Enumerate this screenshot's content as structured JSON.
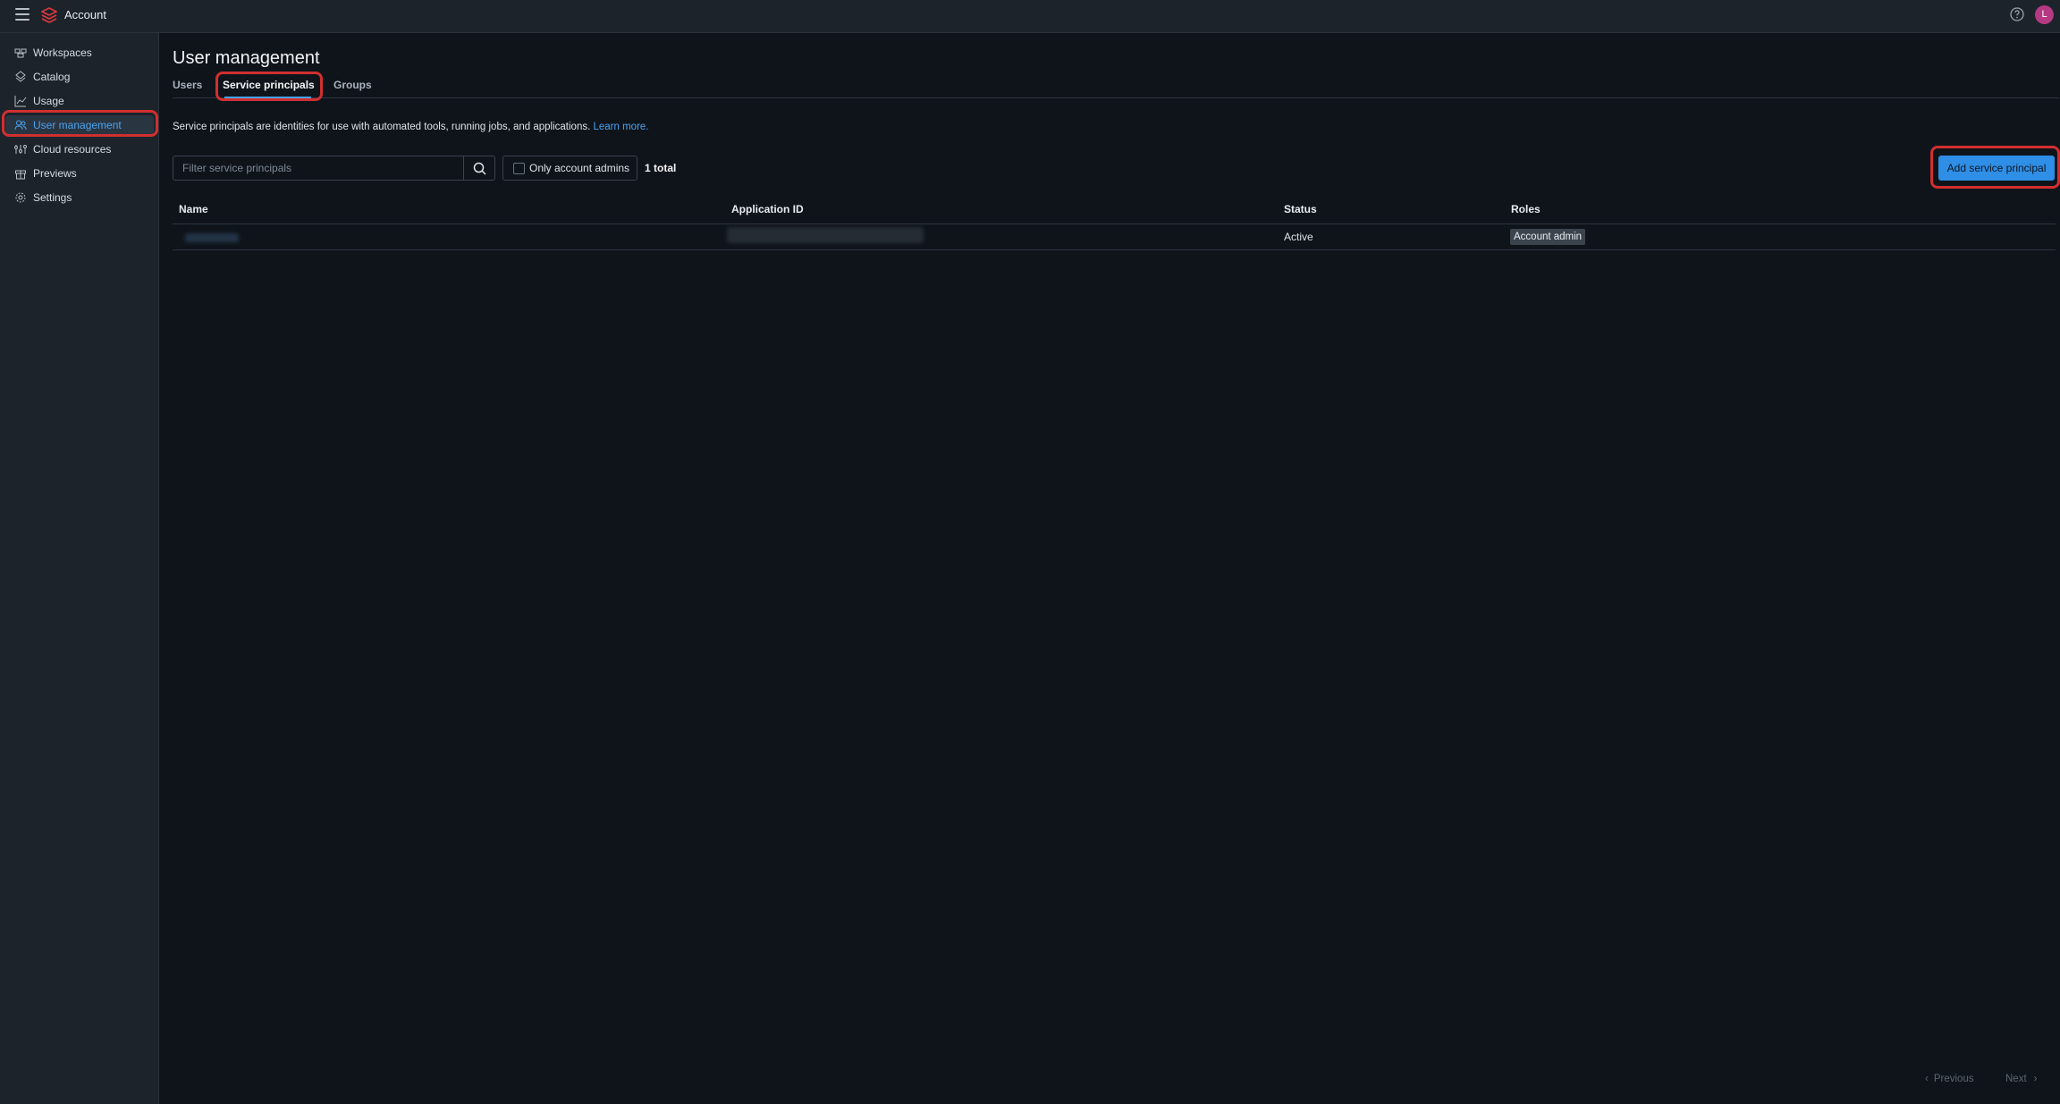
{
  "app": {
    "title": "Account",
    "avatar_initial": "L"
  },
  "sidebar": {
    "items": [
      {
        "label": "Workspaces",
        "icon": "workspaces-icon"
      },
      {
        "label": "Catalog",
        "icon": "catalog-icon"
      },
      {
        "label": "Usage",
        "icon": "usage-chart-icon"
      },
      {
        "label": "User management",
        "icon": "users-icon",
        "active": true
      },
      {
        "label": "Cloud resources",
        "icon": "cloud-resources-icon"
      },
      {
        "label": "Previews",
        "icon": "gift-icon"
      },
      {
        "label": "Settings",
        "icon": "gear-icon"
      }
    ]
  },
  "main": {
    "title": "User management",
    "tabs": [
      {
        "label": "Users"
      },
      {
        "label": "Service principals",
        "active": true
      },
      {
        "label": "Groups"
      }
    ],
    "description": "Service principals are identities for use with automated tools, running jobs, and applications.",
    "learn_more": "Learn more.",
    "filter_placeholder": "Filter service principals",
    "admins_toggle_label": "Only account admins",
    "total": "1 total",
    "add_button": "Add service principal",
    "table": {
      "columns": [
        "Name",
        "Application ID",
        "Status",
        "Roles"
      ],
      "rows": [
        {
          "status": "Active",
          "role": "Account admin"
        }
      ]
    },
    "pager": {
      "previous": "Previous",
      "next": "Next"
    }
  },
  "colors": {
    "accent": "#2f8ee5",
    "highlight": "#d12f2f",
    "background": "#0f141b",
    "sidebar": "#1d232b"
  }
}
